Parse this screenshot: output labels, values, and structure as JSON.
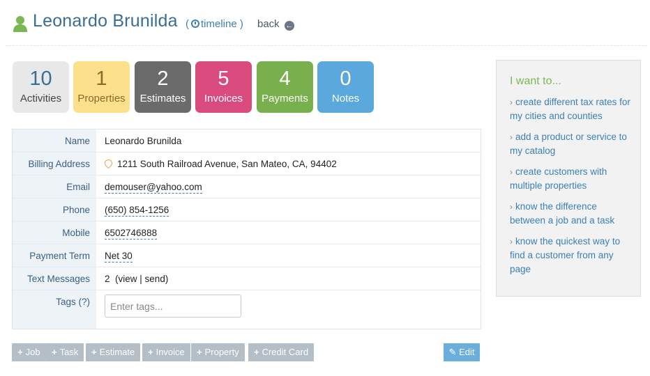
{
  "header": {
    "title": "Leonardo Brunilda",
    "timeline_label": "timeline",
    "back_label": "back"
  },
  "stats": [
    {
      "count": "10",
      "label": "Activities",
      "bg": "#e8e8e8",
      "fg": "#3a6e95",
      "label_fg": "#444444"
    },
    {
      "count": "1",
      "label": "Properties",
      "bg": "#fde08c",
      "fg": "#8a6a2a",
      "label_fg": "#8a6a2a"
    },
    {
      "count": "2",
      "label": "Estimates",
      "bg": "#6b6b6b",
      "fg": "#ffffff",
      "label_fg": "#ffffff"
    },
    {
      "count": "5",
      "label": "Invoices",
      "bg": "#d94b7c",
      "fg": "#ffffff",
      "label_fg": "#ffffff"
    },
    {
      "count": "4",
      "label": "Payments",
      "bg": "#78b04e",
      "fg": "#ffffff",
      "label_fg": "#ffffff"
    },
    {
      "count": "0",
      "label": "Notes",
      "bg": "#5aa8dc",
      "fg": "#ffffff",
      "label_fg": "#ffffff"
    }
  ],
  "details": {
    "name_label": "Name",
    "name_value": "Leonardo Brunilda",
    "billing_label": "Billing Address",
    "billing_value": "1211 South Railroad Avenue, San Mateo, CA, 94402",
    "email_label": "Email",
    "email_value": "demouser@yahoo.com",
    "phone_label": "Phone",
    "phone_value": "(650) 854-1256",
    "mobile_label": "Mobile",
    "mobile_value": "6502746888",
    "term_label": "Payment Term",
    "term_value": "Net 30",
    "text_label": "Text Messages",
    "text_count": "2",
    "text_view": "view",
    "text_send": "send",
    "tags_label": "Tags",
    "tags_help": "(?)",
    "tags_placeholder": "Enter tags..."
  },
  "actions": {
    "job": "Job",
    "task": "Task",
    "estimate": "Estimate",
    "invoice": "Invoice",
    "property": "Property",
    "credit_card": "Credit Card",
    "edit": "Edit"
  },
  "side": {
    "heading": "I want to...",
    "links": [
      "create different tax rates for my cities and counties",
      "add a product or service to my catalog",
      "create customers with multiple properties",
      "know the difference between a job and a task",
      "know the quickest way to find a customer from any page"
    ]
  },
  "icons": {
    "person": "person-icon",
    "clock": "clock-icon",
    "back": "back-arrow-circle-icon",
    "pin": "map-pin-icon",
    "plus": "plus-icon",
    "edit": "edit-icon",
    "chevron": "chevron-right-icon"
  }
}
